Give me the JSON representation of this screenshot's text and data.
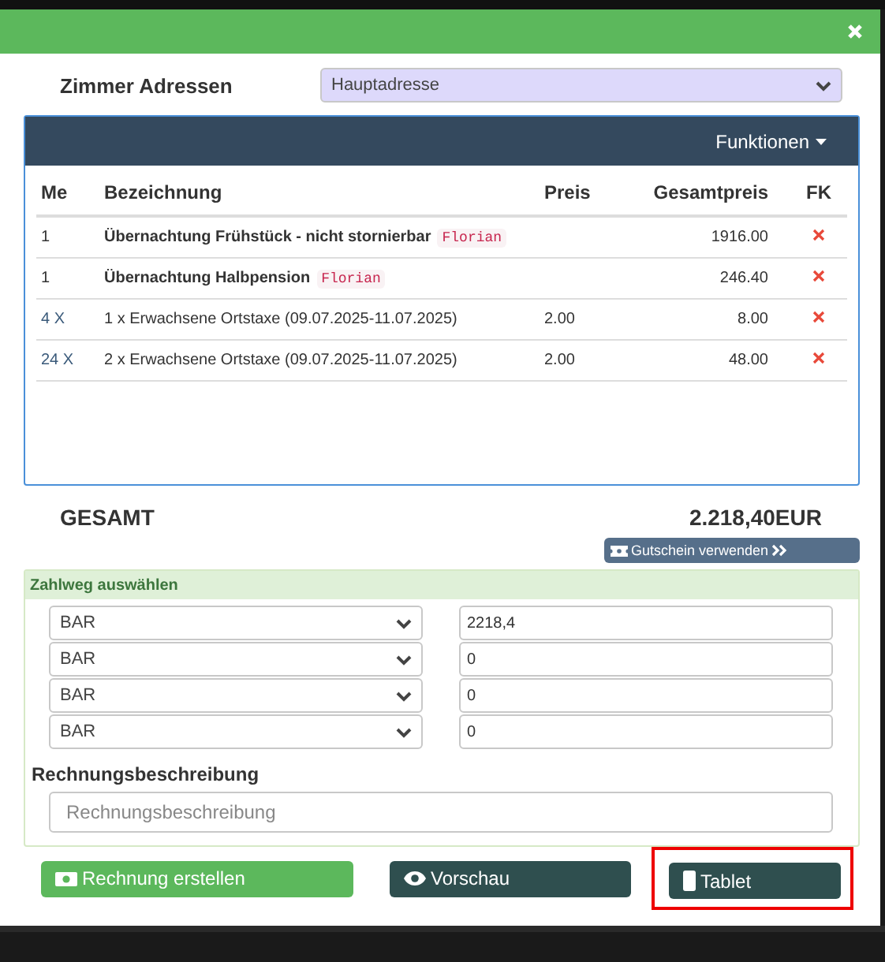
{
  "address": {
    "label": "Zimmer Adressen",
    "value": "Hauptadresse"
  },
  "panel": {
    "menu": "Funktionen"
  },
  "table": {
    "columns": [
      "Me",
      "Bezeichnung",
      "Preis",
      "Gesamtpreis",
      "FK"
    ],
    "rows": [
      {
        "kind": "room",
        "qty": "1",
        "name": "Übernachtung Frühstück - nicht stornierbar",
        "tag": "Florian",
        "total": "1916.00"
      },
      {
        "kind": "room",
        "qty": "1",
        "name": "Übernachtung Halbpension",
        "tag": "Florian",
        "total": "246.40"
      },
      {
        "kind": "tax",
        "qty": "4 X",
        "name": "1 x Erwachsene Ortstaxe (09.07.2025-11.07.2025)",
        "price": "2.00",
        "total": "8.00"
      },
      {
        "kind": "tax",
        "qty": "24 X",
        "name": "2 x Erwachsene Ortstaxe (09.07.2025-11.07.2025)",
        "price": "2.00",
        "total": "48.00"
      }
    ]
  },
  "total": {
    "label": "GESAMT",
    "amount": "2.218,40EUR"
  },
  "voucher_button": "Gutschein verwenden",
  "payment": {
    "title": "Zahlweg auswählen",
    "rows": [
      {
        "method": "BAR",
        "amount": "2218,4"
      },
      {
        "method": "BAR",
        "amount": "0"
      },
      {
        "method": "BAR",
        "amount": "0"
      },
      {
        "method": "BAR",
        "amount": "0"
      }
    ]
  },
  "description": {
    "label": "Rechnungsbeschreibung",
    "placeholder": "Rechnungsbeschreibung"
  },
  "buttons": [
    {
      "kind": "create",
      "label": "Rechnung erstellen",
      "highlighted": false
    },
    {
      "kind": "preview",
      "label": "Vorschau",
      "highlighted": false
    },
    {
      "kind": "tablet",
      "label": "Tablet",
      "highlighted": true
    }
  ]
}
